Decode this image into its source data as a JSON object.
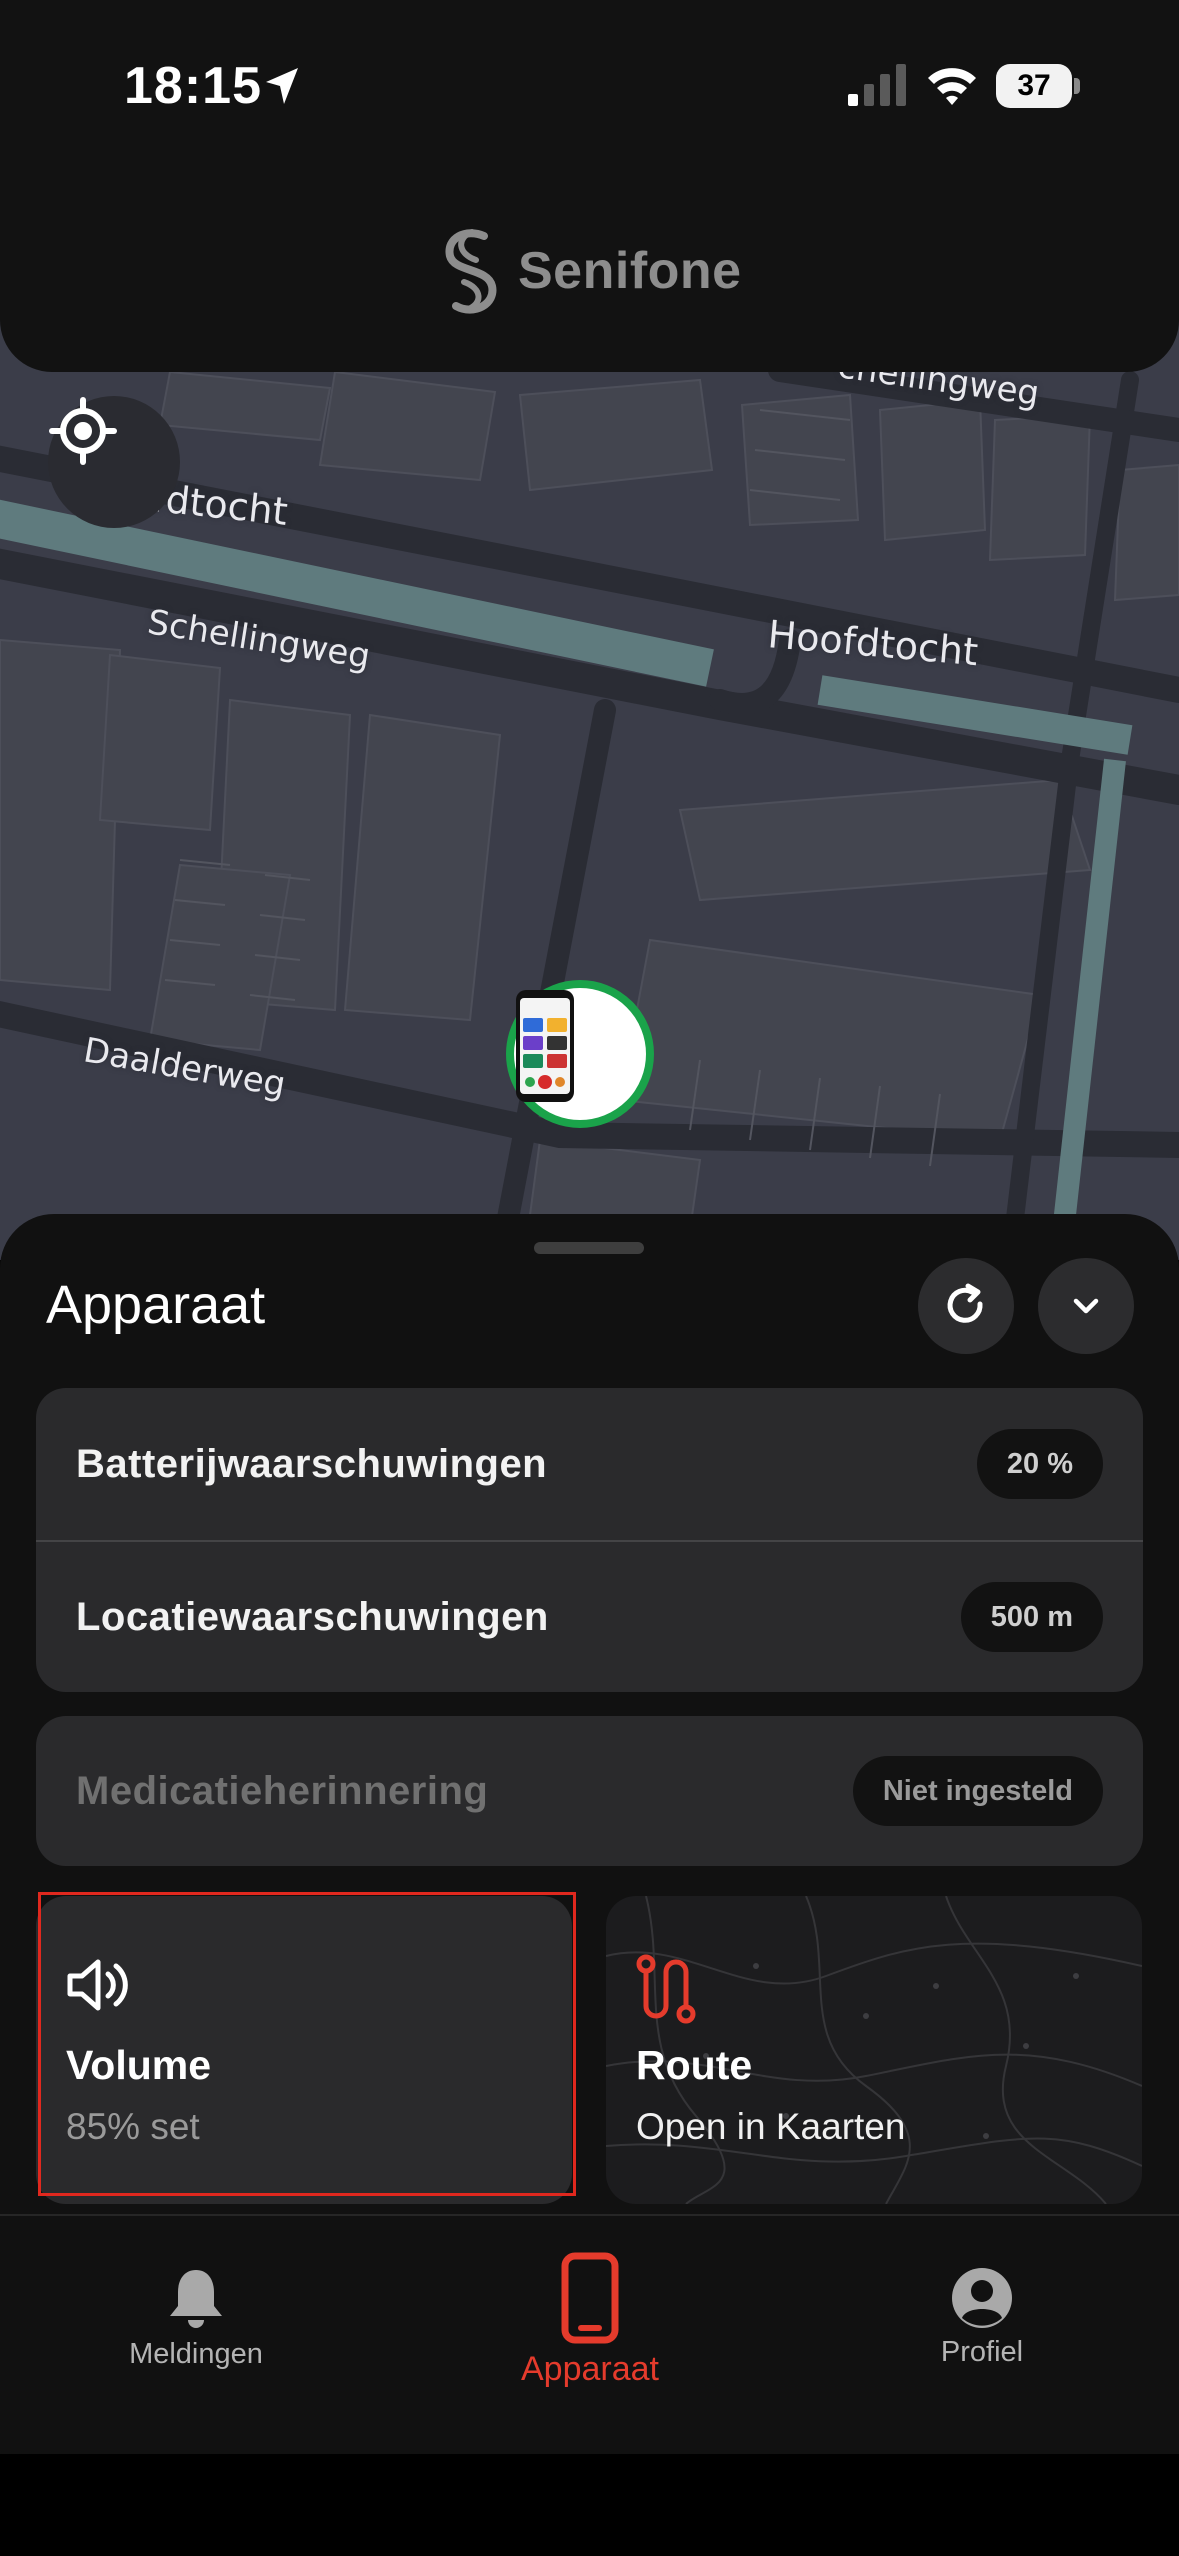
{
  "status_bar": {
    "time": "18:15",
    "battery": "37"
  },
  "header": {
    "brand": "Senifone"
  },
  "map": {
    "labels": {
      "hoofdtocht_1": "Hoofdtocht",
      "hoofdtocht_2": "Hoofdtocht",
      "schellingweg_1": "Schellingweg",
      "schellingweg_2": "chellingweg",
      "daalderweg": "Daalderweg"
    }
  },
  "sheet": {
    "title": "Apparaat",
    "alerts": [
      {
        "label": "Batterijwaarschuwingen",
        "value": "20 %"
      },
      {
        "label": "Locatiewaarschuwingen",
        "value": "500 m"
      }
    ],
    "medication": {
      "label": "Medicatieherinnering",
      "value": "Niet ingesteld"
    },
    "volume_tile": {
      "title": "Volume",
      "subtitle": "85% set"
    },
    "route_tile": {
      "title": "Route",
      "subtitle": "Open in Kaarten"
    }
  },
  "tabbar": {
    "tabs": [
      {
        "label": "Meldingen",
        "icon": "bell-icon"
      },
      {
        "label": "Apparaat",
        "icon": "phone-icon",
        "active": true
      },
      {
        "label": "Profiel",
        "icon": "profile-icon"
      }
    ]
  },
  "colors": {
    "accent": "#e53b2c",
    "marker_ring": "#1aa34a",
    "map_base": "#3b3d49",
    "water": "#5f7b7e"
  }
}
